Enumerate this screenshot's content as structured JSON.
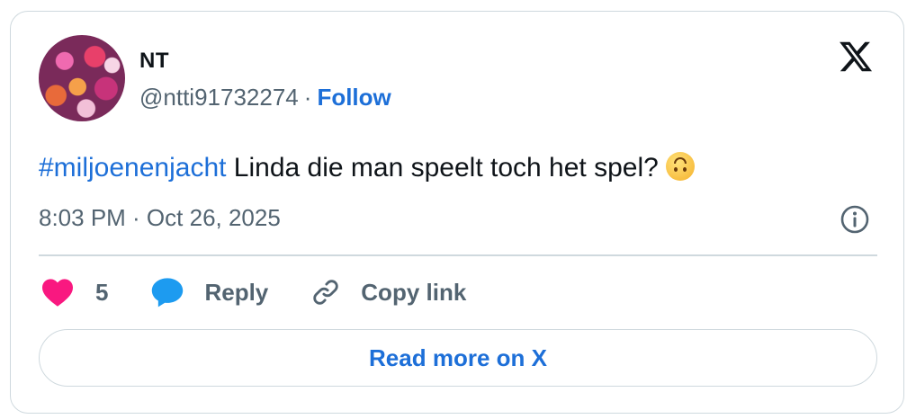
{
  "author": {
    "display_name": "NT",
    "handle": "@ntti91732274",
    "separator": "·",
    "follow_label": "Follow",
    "avatar": "flower-photo-avatar"
  },
  "brand": {
    "logo": "x-logo-icon"
  },
  "tweet": {
    "hashtag": "#miljoenenjacht",
    "text": " Linda die man speelt toch het spel?",
    "emoji": "upside-down-face-emoji",
    "timestamp": "8:03 PM · Oct 26, 2025"
  },
  "actions": {
    "like_count": "5",
    "reply_label": "Reply",
    "copy_link_label": "Copy link"
  },
  "footer": {
    "read_more_label": "Read more on X"
  },
  "colors": {
    "link": "#1d6fd8",
    "text": "#0f1419",
    "secondary": "#536471",
    "border": "#cfd9de",
    "heart": "#f91880",
    "reply_bubble": "#1d9bf0"
  }
}
